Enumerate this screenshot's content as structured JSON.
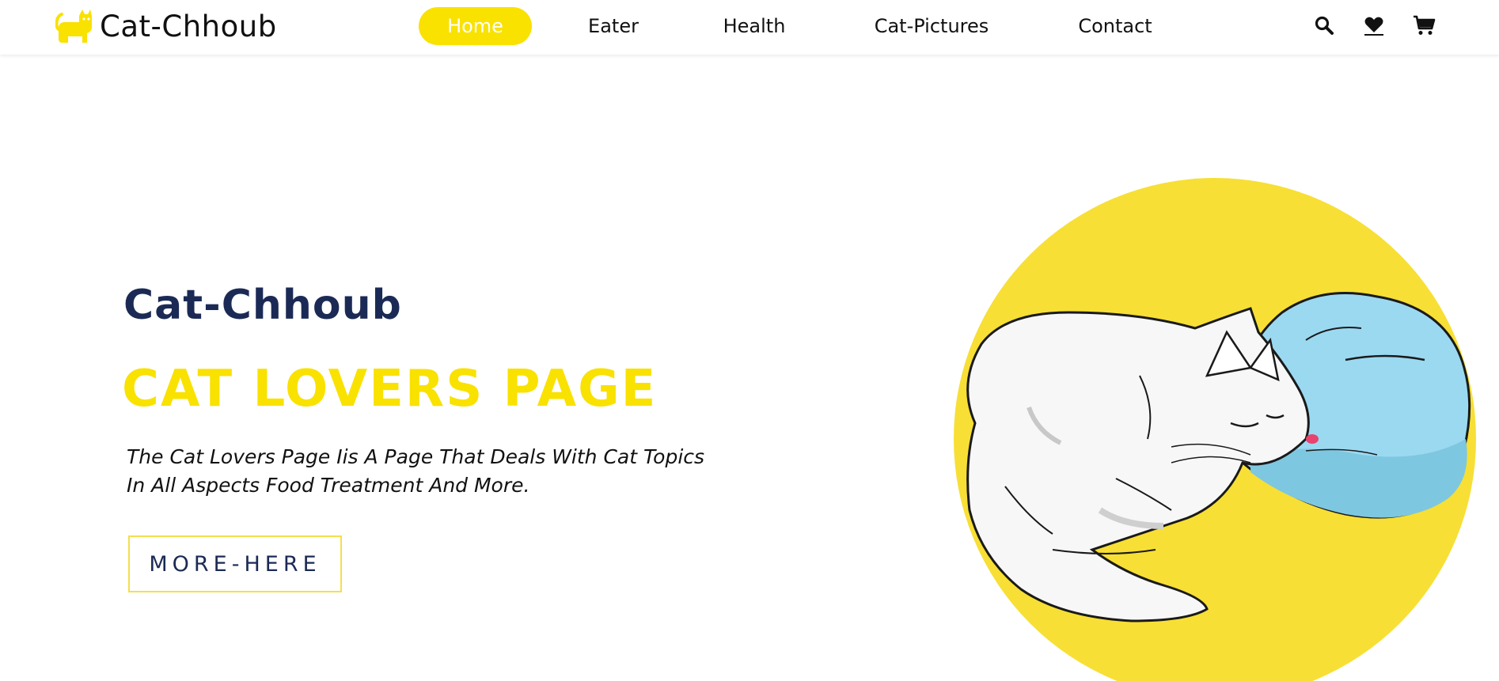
{
  "header": {
    "brand": {
      "name": "Cat-Chhoub",
      "logo_icon": "cat-icon"
    },
    "nav": [
      {
        "label": "Home",
        "active": true
      },
      {
        "label": "Eater",
        "active": false
      },
      {
        "label": "Health",
        "active": false
      },
      {
        "label": "Cat-Pictures",
        "active": false
      },
      {
        "label": "Contact",
        "active": false
      }
    ],
    "icons": [
      "search-icon",
      "heart-icon",
      "cart-icon"
    ]
  },
  "hero": {
    "subtitle": "Cat-Chhoub",
    "title": "CAT LOVERS PAGE",
    "description": "The Cat Lovers Page Iis A Page That Deals With Cat Topics In All Aspects Food Treatment And More.",
    "button_label": "MORE-HERE",
    "illustration": "sleeping-cat-illustration"
  },
  "colors": {
    "accent": "#f9e100",
    "navy": "#1b2a55",
    "circle": "#f7df35",
    "pillow": "#9bd9f1"
  }
}
